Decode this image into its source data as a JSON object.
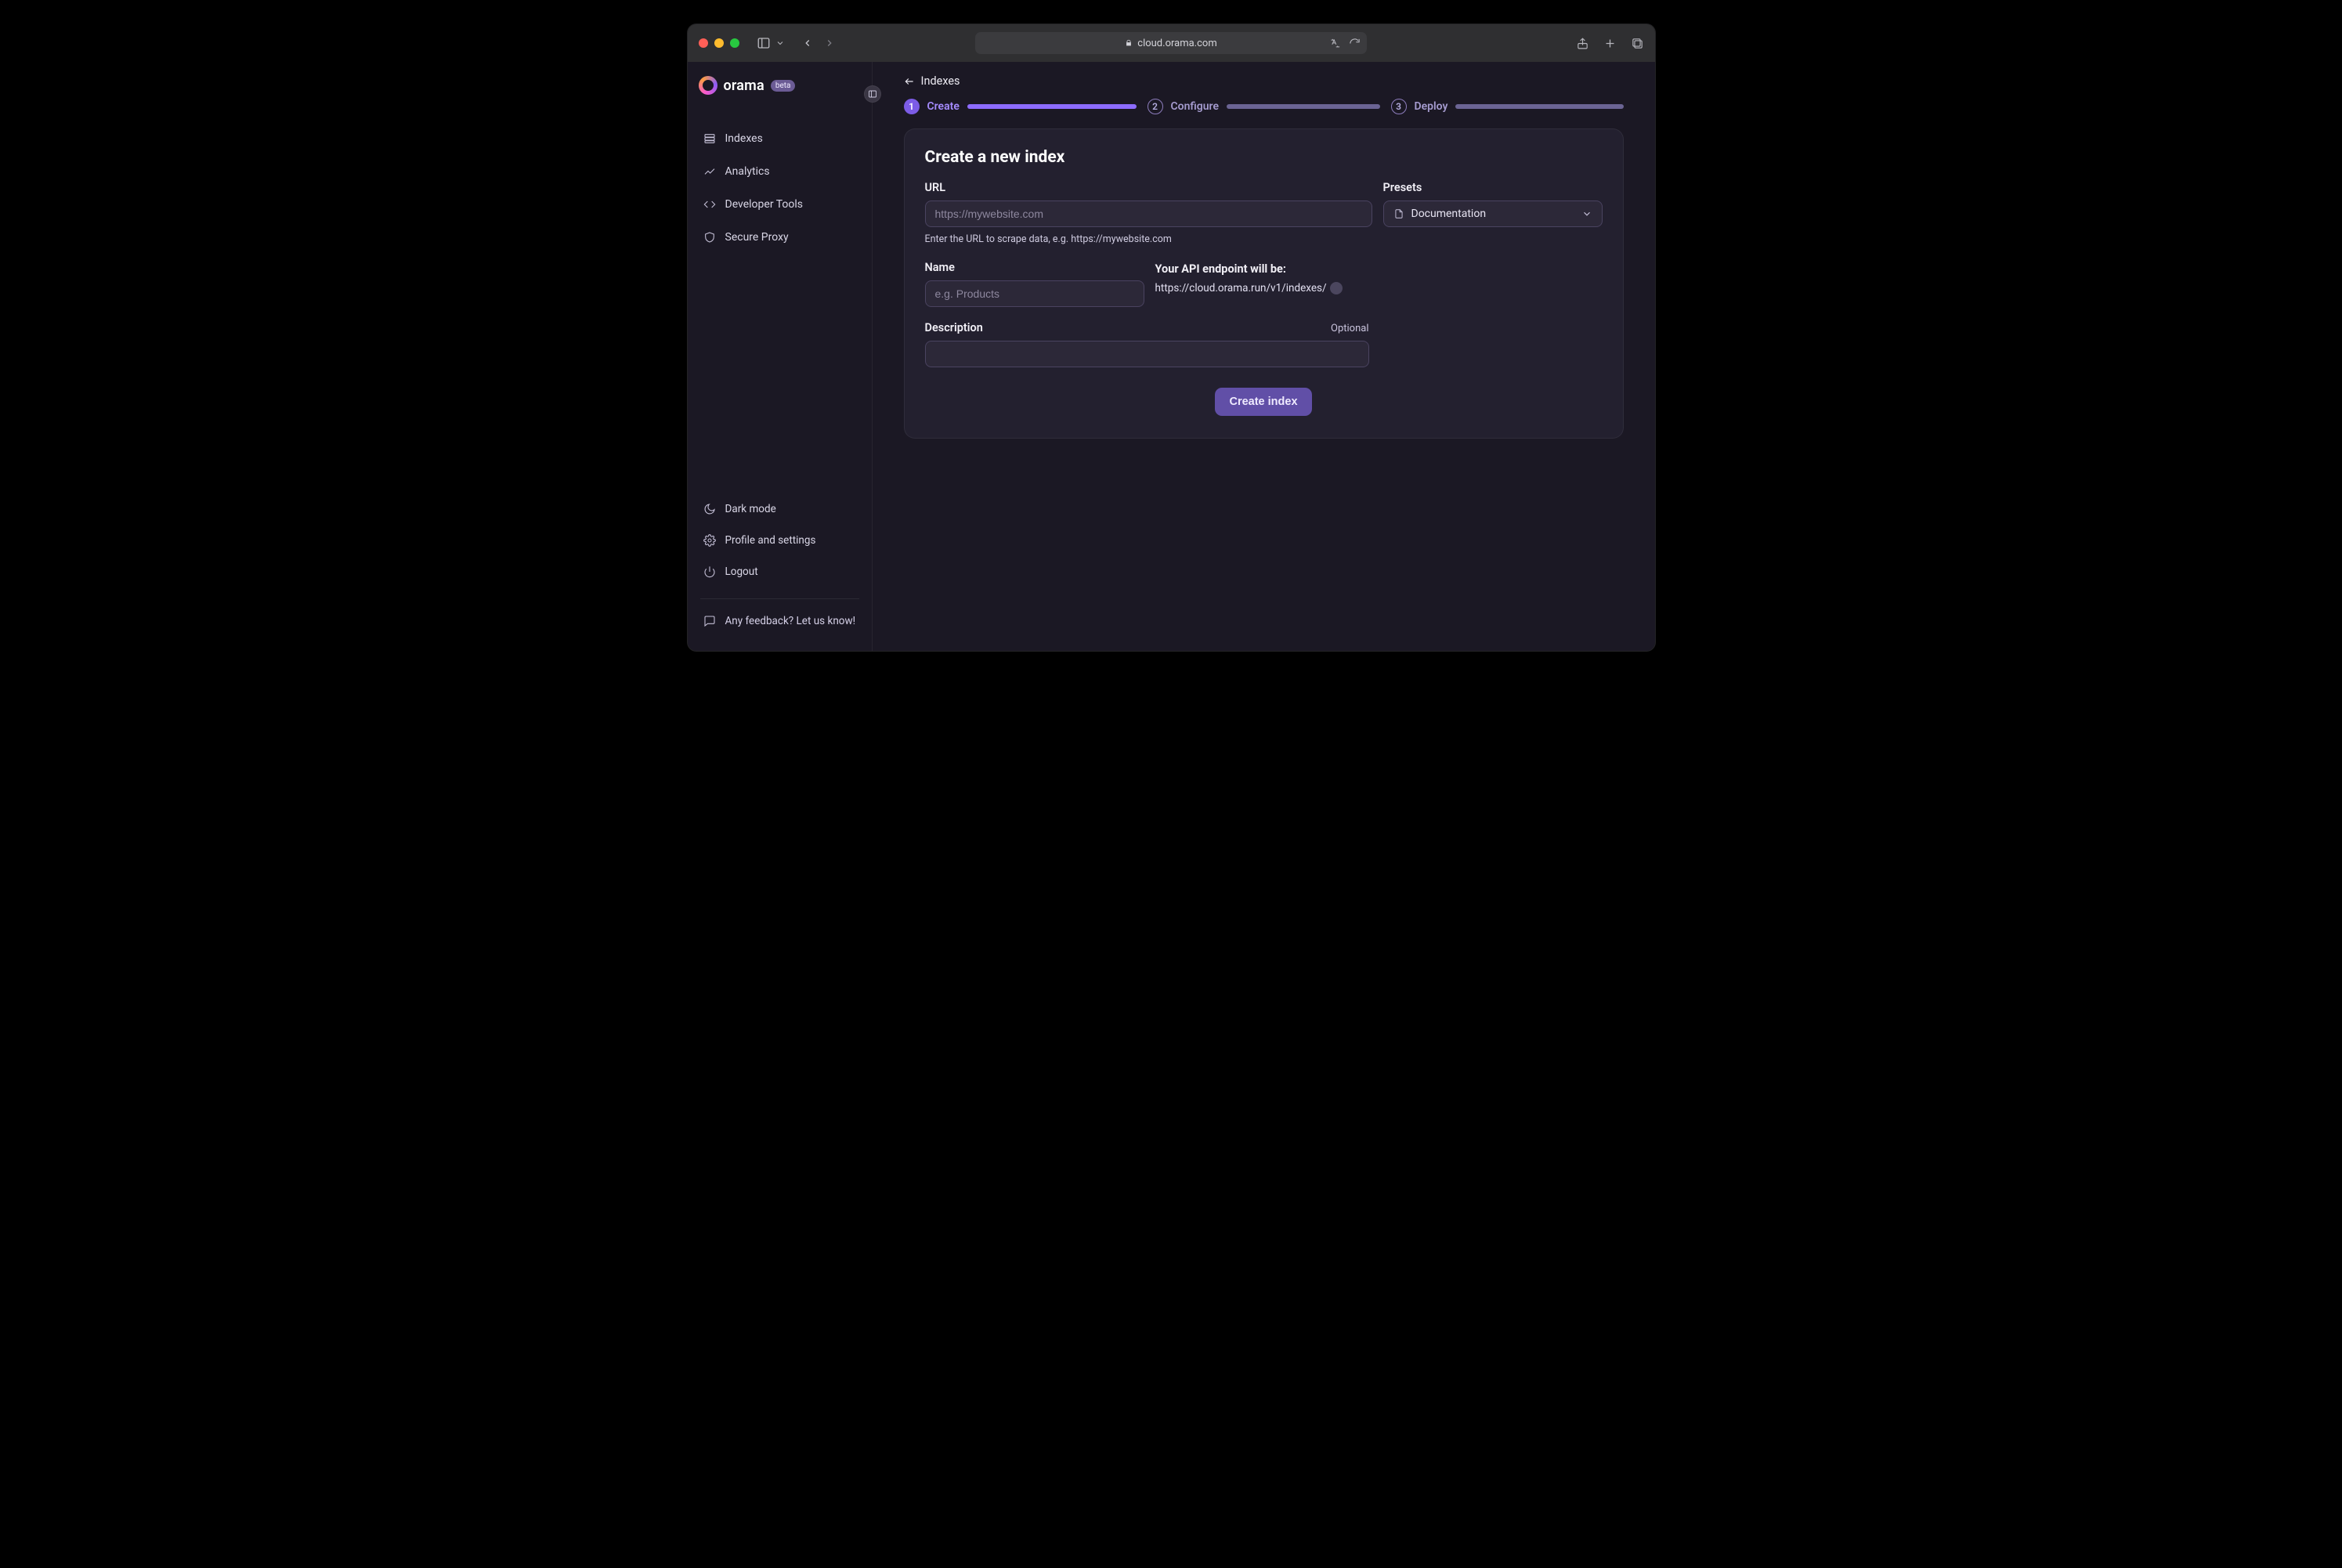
{
  "browser": {
    "url": "cloud.orama.com"
  },
  "brand": {
    "name": "orama",
    "badge": "beta"
  },
  "sidebar": {
    "primary": [
      {
        "label": "Indexes"
      },
      {
        "label": "Analytics"
      },
      {
        "label": "Developer Tools"
      },
      {
        "label": "Secure Proxy"
      }
    ],
    "secondary": [
      {
        "label": "Dark mode"
      },
      {
        "label": "Profile and settings"
      },
      {
        "label": "Logout"
      }
    ],
    "feedback": "Any feedback? Let us know!"
  },
  "breadcrumb": {
    "label": "Indexes"
  },
  "stepper": {
    "steps": [
      {
        "num": "1",
        "label": "Create"
      },
      {
        "num": "2",
        "label": "Configure"
      },
      {
        "num": "3",
        "label": "Deploy"
      }
    ]
  },
  "form": {
    "title": "Create a new index",
    "url": {
      "label": "URL",
      "placeholder": "https://mywebsite.com",
      "value": "",
      "hint": "Enter the URL to scrape data, e.g. https://mywebsite.com"
    },
    "presets": {
      "label": "Presets",
      "selected": "Documentation"
    },
    "name": {
      "label": "Name",
      "placeholder": "e.g. Products",
      "value": ""
    },
    "api": {
      "title": "Your API endpoint will be:",
      "base": "https://cloud.orama.run/v1/indexes/"
    },
    "description": {
      "label": "Description",
      "optional_text": "Optional",
      "value": ""
    },
    "submit_label": "Create index"
  }
}
